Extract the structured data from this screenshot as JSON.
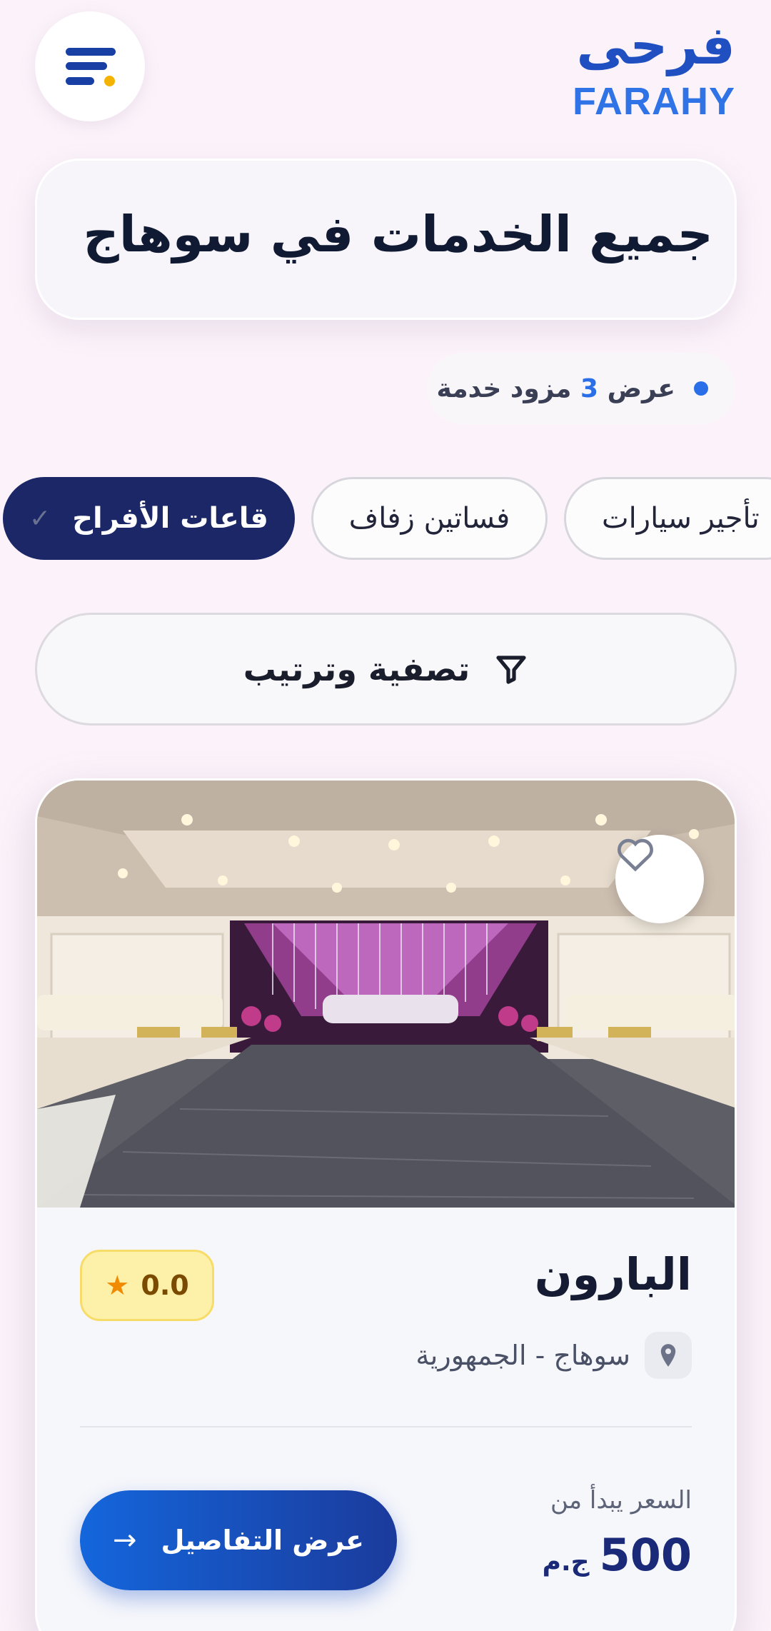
{
  "header": {
    "logo_ar": "فرحى",
    "logo_en": "FARAHY",
    "menu_icon": "menu-icon"
  },
  "title": "جميع الخدمات في سوهاج",
  "count": {
    "prefix": "عرض",
    "number": "3",
    "suffix": "مزود خدمة"
  },
  "categories": [
    {
      "label": "تأجير سيارات",
      "selected": false
    },
    {
      "label": "فساتين زفاف",
      "selected": false
    },
    {
      "label": "قاعات الأفراح",
      "selected": true
    }
  ],
  "filter": {
    "label": "تصفية وترتيب",
    "icon": "filter-icon"
  },
  "listing": {
    "name": "البارون",
    "rating": "0.0",
    "location": "سوهاج - الجمهورية",
    "price_label": "السعر يبدأ من",
    "price": "500",
    "currency": "ج.م",
    "details_label": "عرض التفاصيل"
  },
  "colors": {
    "primary": "#1b2766",
    "accent": "#2a6ee8",
    "background": "#fcf3fa",
    "rating_bg": "#fdf0a8"
  }
}
